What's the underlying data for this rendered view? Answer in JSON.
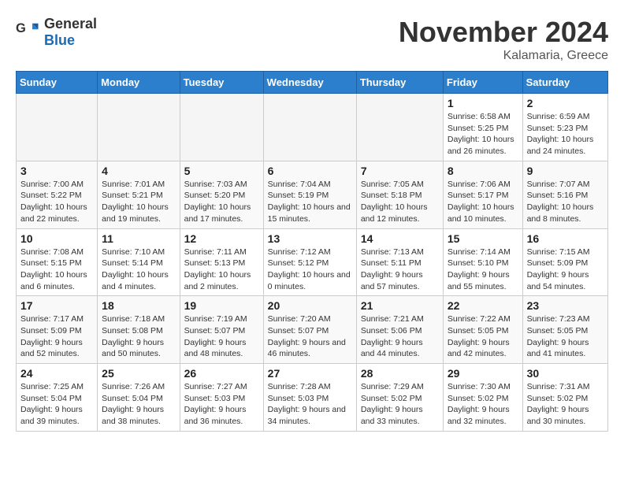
{
  "header": {
    "logo_general": "General",
    "logo_blue": "Blue",
    "month_title": "November 2024",
    "location": "Kalamaria, Greece"
  },
  "weekdays": [
    "Sunday",
    "Monday",
    "Tuesday",
    "Wednesday",
    "Thursday",
    "Friday",
    "Saturday"
  ],
  "weeks": [
    [
      {
        "day": "",
        "empty": true
      },
      {
        "day": "",
        "empty": true
      },
      {
        "day": "",
        "empty": true
      },
      {
        "day": "",
        "empty": true
      },
      {
        "day": "",
        "empty": true
      },
      {
        "day": "1",
        "sunrise": "6:58 AM",
        "sunset": "5:25 PM",
        "daylight": "10 hours and 26 minutes."
      },
      {
        "day": "2",
        "sunrise": "6:59 AM",
        "sunset": "5:23 PM",
        "daylight": "10 hours and 24 minutes."
      }
    ],
    [
      {
        "day": "3",
        "sunrise": "7:00 AM",
        "sunset": "5:22 PM",
        "daylight": "10 hours and 22 minutes."
      },
      {
        "day": "4",
        "sunrise": "7:01 AM",
        "sunset": "5:21 PM",
        "daylight": "10 hours and 19 minutes."
      },
      {
        "day": "5",
        "sunrise": "7:03 AM",
        "sunset": "5:20 PM",
        "daylight": "10 hours and 17 minutes."
      },
      {
        "day": "6",
        "sunrise": "7:04 AM",
        "sunset": "5:19 PM",
        "daylight": "10 hours and 15 minutes."
      },
      {
        "day": "7",
        "sunrise": "7:05 AM",
        "sunset": "5:18 PM",
        "daylight": "10 hours and 12 minutes."
      },
      {
        "day": "8",
        "sunrise": "7:06 AM",
        "sunset": "5:17 PM",
        "daylight": "10 hours and 10 minutes."
      },
      {
        "day": "9",
        "sunrise": "7:07 AM",
        "sunset": "5:16 PM",
        "daylight": "10 hours and 8 minutes."
      }
    ],
    [
      {
        "day": "10",
        "sunrise": "7:08 AM",
        "sunset": "5:15 PM",
        "daylight": "10 hours and 6 minutes."
      },
      {
        "day": "11",
        "sunrise": "7:10 AM",
        "sunset": "5:14 PM",
        "daylight": "10 hours and 4 minutes."
      },
      {
        "day": "12",
        "sunrise": "7:11 AM",
        "sunset": "5:13 PM",
        "daylight": "10 hours and 2 minutes."
      },
      {
        "day": "13",
        "sunrise": "7:12 AM",
        "sunset": "5:12 PM",
        "daylight": "10 hours and 0 minutes."
      },
      {
        "day": "14",
        "sunrise": "7:13 AM",
        "sunset": "5:11 PM",
        "daylight": "9 hours and 57 minutes."
      },
      {
        "day": "15",
        "sunrise": "7:14 AM",
        "sunset": "5:10 PM",
        "daylight": "9 hours and 55 minutes."
      },
      {
        "day": "16",
        "sunrise": "7:15 AM",
        "sunset": "5:09 PM",
        "daylight": "9 hours and 54 minutes."
      }
    ],
    [
      {
        "day": "17",
        "sunrise": "7:17 AM",
        "sunset": "5:09 PM",
        "daylight": "9 hours and 52 minutes."
      },
      {
        "day": "18",
        "sunrise": "7:18 AM",
        "sunset": "5:08 PM",
        "daylight": "9 hours and 50 minutes."
      },
      {
        "day": "19",
        "sunrise": "7:19 AM",
        "sunset": "5:07 PM",
        "daylight": "9 hours and 48 minutes."
      },
      {
        "day": "20",
        "sunrise": "7:20 AM",
        "sunset": "5:07 PM",
        "daylight": "9 hours and 46 minutes."
      },
      {
        "day": "21",
        "sunrise": "7:21 AM",
        "sunset": "5:06 PM",
        "daylight": "9 hours and 44 minutes."
      },
      {
        "day": "22",
        "sunrise": "7:22 AM",
        "sunset": "5:05 PM",
        "daylight": "9 hours and 42 minutes."
      },
      {
        "day": "23",
        "sunrise": "7:23 AM",
        "sunset": "5:05 PM",
        "daylight": "9 hours and 41 minutes."
      }
    ],
    [
      {
        "day": "24",
        "sunrise": "7:25 AM",
        "sunset": "5:04 PM",
        "daylight": "9 hours and 39 minutes."
      },
      {
        "day": "25",
        "sunrise": "7:26 AM",
        "sunset": "5:04 PM",
        "daylight": "9 hours and 38 minutes."
      },
      {
        "day": "26",
        "sunrise": "7:27 AM",
        "sunset": "5:03 PM",
        "daylight": "9 hours and 36 minutes."
      },
      {
        "day": "27",
        "sunrise": "7:28 AM",
        "sunset": "5:03 PM",
        "daylight": "9 hours and 34 minutes."
      },
      {
        "day": "28",
        "sunrise": "7:29 AM",
        "sunset": "5:02 PM",
        "daylight": "9 hours and 33 minutes."
      },
      {
        "day": "29",
        "sunrise": "7:30 AM",
        "sunset": "5:02 PM",
        "daylight": "9 hours and 32 minutes."
      },
      {
        "day": "30",
        "sunrise": "7:31 AM",
        "sunset": "5:02 PM",
        "daylight": "9 hours and 30 minutes."
      }
    ]
  ]
}
